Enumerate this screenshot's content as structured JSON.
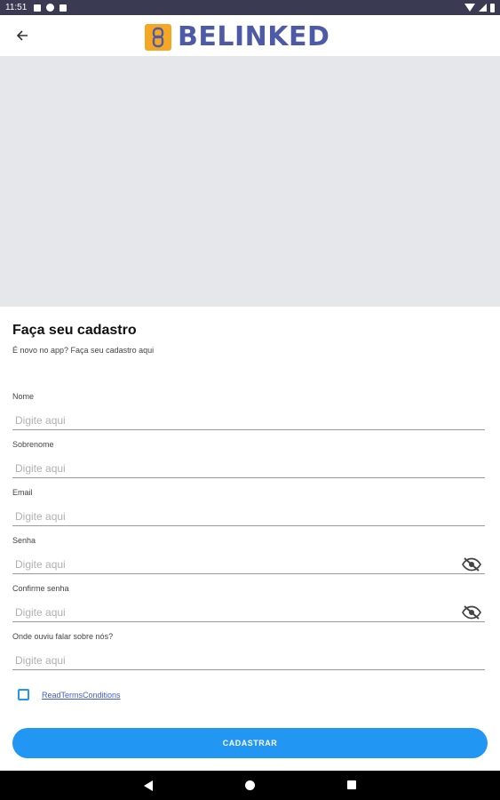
{
  "status_bar": {
    "time": "11:51",
    "icons": [
      "notification-icon",
      "app-icon",
      "sd-card-icon",
      "wifi-icon",
      "signal-icon",
      "battery-icon"
    ]
  },
  "app_bar": {
    "logo_text": "BELINKED",
    "back_icon": "arrow-back-icon",
    "colors": {
      "logo_text": "#4d5aa8",
      "logo_mark": "#f5a623"
    }
  },
  "form": {
    "title": "Faça seu cadastro",
    "subtitle": "É novo no app? Faça seu cadastro aqui",
    "fields": [
      {
        "label": "Nome",
        "placeholder": "Digite aqui",
        "value": ""
      },
      {
        "label": "Sobrenome",
        "placeholder": "Digite aqui",
        "value": ""
      },
      {
        "label": "Email",
        "placeholder": "Digite aqui",
        "value": ""
      },
      {
        "label": "Senha",
        "placeholder": "Digite aqui",
        "value": "",
        "icon": "eye-off-icon"
      },
      {
        "label": "Confirme senha",
        "placeholder": "Digite aqui",
        "value": "",
        "icon": "eye-off-icon"
      },
      {
        "label": "Onde ouviu falar sobre nós?",
        "placeholder": "Digite aqui",
        "value": ""
      }
    ],
    "terms_link": "ReadTermsConditions",
    "terms_checked": false,
    "submit_label": "CADASTRAR",
    "colors": {
      "primary": "#2196f3",
      "link": "#3b5bdb"
    }
  },
  "nav_bar": {
    "icons": [
      "nav-back-icon",
      "nav-home-icon",
      "nav-recents-icon"
    ]
  }
}
